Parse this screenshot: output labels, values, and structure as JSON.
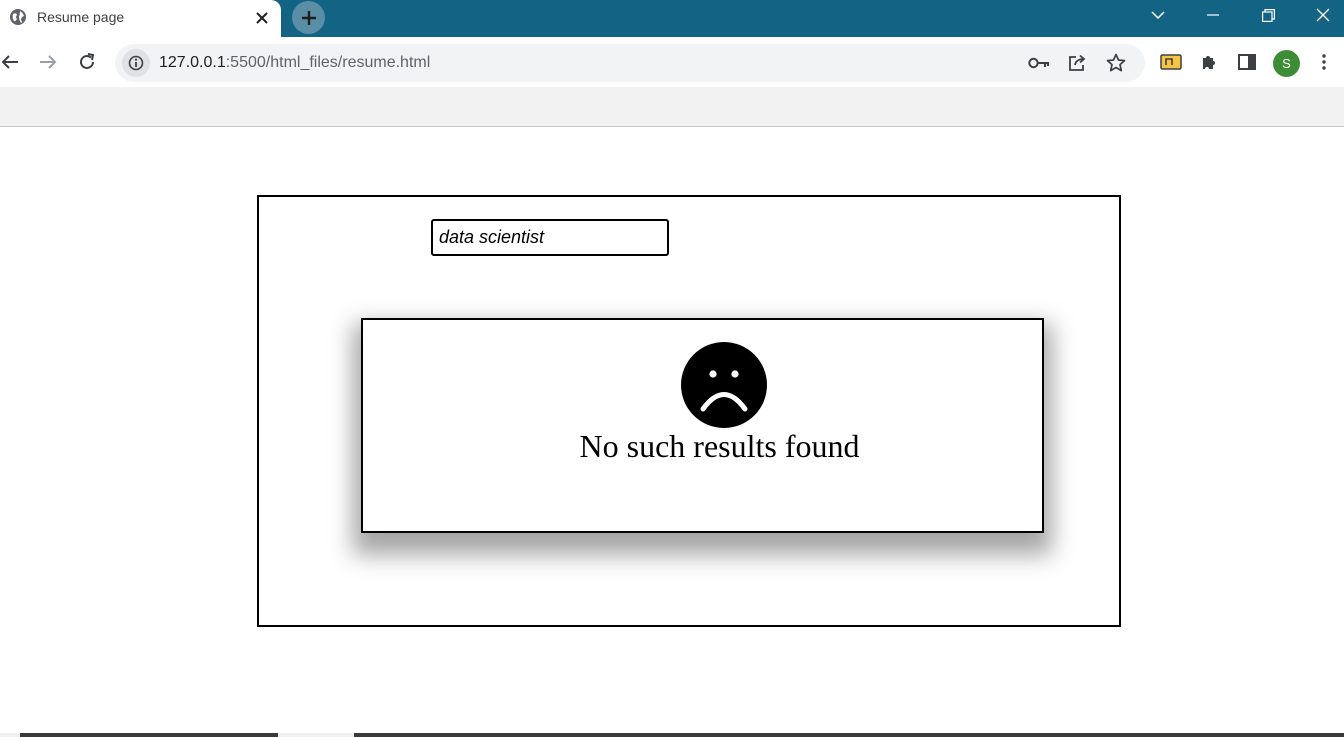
{
  "browser": {
    "tab": {
      "title": "Resume page",
      "favicon": "globe-icon"
    },
    "url": {
      "host": "127.0.0.1",
      "path": ":5500/html_files/resume.html"
    },
    "avatar_letter": "S",
    "colors": {
      "tabstrip": "#136384",
      "avatar": "#3c8d35"
    }
  },
  "page": {
    "search": {
      "value": "data scientist"
    },
    "result": {
      "icon": "sad-face-icon",
      "message": "No such results found"
    }
  }
}
